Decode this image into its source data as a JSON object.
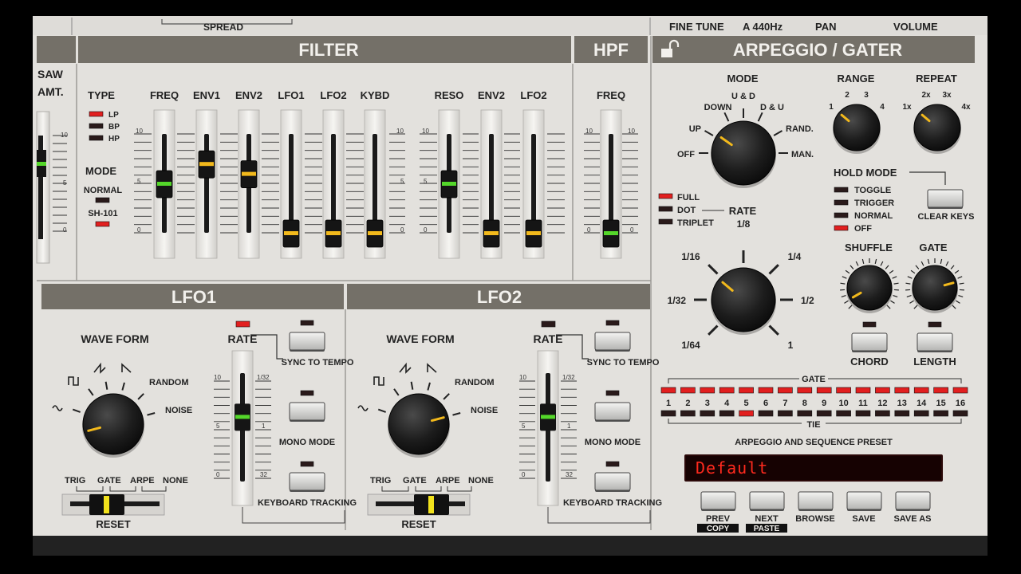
{
  "top_strip": {
    "spread": "SPREAD",
    "fine_tune": "FINE TUNE",
    "a440": "A 440Hz",
    "pan": "PAN",
    "volume": "VOLUME"
  },
  "osc": {
    "saw": "SAW",
    "amt": "AMT."
  },
  "filter": {
    "title": "FILTER",
    "type_label": "TYPE",
    "types": [
      {
        "label": "LP",
        "on": true
      },
      {
        "label": "BP",
        "on": false
      },
      {
        "label": "HP",
        "on": false
      }
    ],
    "mode_label": "MODE",
    "modes": [
      {
        "label": "NORMAL",
        "on": false
      },
      {
        "label": "SH-101",
        "on": true
      }
    ],
    "sliders": [
      {
        "label": "FREQ",
        "value": 0.5,
        "cap": "green"
      },
      {
        "label": "ENV1",
        "value": 0.7,
        "cap": "yellow"
      },
      {
        "label": "ENV2",
        "value": 0.6,
        "cap": "yellow"
      },
      {
        "label": "LFO1",
        "value": 0.0,
        "cap": "yellow"
      },
      {
        "label": "LFO2",
        "value": 0.0,
        "cap": "yellow"
      },
      {
        "label": "KYBD",
        "value": 0.0,
        "cap": "yellow"
      },
      {
        "label": "RESO",
        "value": 0.5,
        "cap": "green"
      },
      {
        "label": "ENV2",
        "value": 0.0,
        "cap": "yellow"
      },
      {
        "label": "LFO2",
        "value": 0.0,
        "cap": "yellow"
      }
    ],
    "scale": {
      "max": "10",
      "mid": "5",
      "min": "0"
    }
  },
  "hpf": {
    "title": "HPF",
    "freq_label": "FREQ",
    "value": 0.0,
    "cap": "green"
  },
  "lfo1": {
    "title": "LFO1",
    "waveform_label": "WAVE FORM",
    "random": "RANDOM",
    "noise": "NOISE",
    "rate_label": "RATE",
    "sync_label": "SYNC TO TEMPO",
    "mono_label": "MONO MODE",
    "kbd_label": "KEYBOARD TRACKING",
    "reset_opts": [
      "TRIG",
      "GATE",
      "ARPE",
      "NONE"
    ],
    "reset_label": "RESET",
    "rate_value": 0.6,
    "rate_led": true,
    "scale": {
      "max": "10",
      "max2": "1/32",
      "mid": "5",
      "mid2": "1",
      "min": "0",
      "min2": "32"
    }
  },
  "lfo2": {
    "title": "LFO2",
    "waveform_label": "WAVE FORM",
    "random": "RANDOM",
    "noise": "NOISE",
    "rate_label": "RATE",
    "sync_label": "SYNC TO TEMPO",
    "mono_label": "MONO MODE",
    "kbd_label": "KEYBOARD TRACKING",
    "reset_opts": [
      "TRIG",
      "GATE",
      "ARPE",
      "NONE"
    ],
    "reset_label": "RESET",
    "rate_value": 0.6,
    "rate_led": false,
    "scale": {
      "max": "10",
      "max2": "1/32",
      "mid": "5",
      "mid2": "1",
      "min": "0",
      "min2": "32"
    }
  },
  "arp": {
    "title": "ARPEGGIO / GATER",
    "mode_label": "MODE",
    "mode_opts": [
      "OFF",
      "UP",
      "DOWN",
      "U & D",
      "D & U",
      "RAND.",
      "MAN."
    ],
    "range_label": "RANGE",
    "range_opts": [
      "1",
      "2",
      "3",
      "4"
    ],
    "repeat_label": "REPEAT",
    "repeat_opts": [
      "1x",
      "2x",
      "3x",
      "4x"
    ],
    "hold_label": "HOLD MODE",
    "hold_opts": [
      {
        "label": "TOGGLE",
        "on": false
      },
      {
        "label": "TRIGGER",
        "on": false
      },
      {
        "label": "NORMAL",
        "on": false
      },
      {
        "label": "OFF",
        "on": true
      }
    ],
    "clear_keys": "CLEAR KEYS",
    "rate_types": [
      {
        "label": "FULL",
        "on": true
      },
      {
        "label": "DOT",
        "on": false
      },
      {
        "label": "TRIPLET",
        "on": false
      }
    ],
    "rate_label": "RATE",
    "rate_opts": [
      "1/64",
      "1/32",
      "1/16",
      "1/8",
      "1/4",
      "1/2",
      "1"
    ],
    "shuffle_label": "SHUFFLE",
    "gate_label": "GATE",
    "chord_label": "CHORD",
    "length_label": "LENGTH",
    "gate_header": "GATE",
    "tie_header": "TIE",
    "steps": [
      "1",
      "2",
      "3",
      "4",
      "5",
      "6",
      "7",
      "8",
      "9",
      "10",
      "11",
      "12",
      "13",
      "14",
      "15",
      "16"
    ],
    "tie_on_step": "5",
    "preset_label": "ARPEGGIO AND SEQUENCE PRESET",
    "preset_name": "Default",
    "buttons": [
      {
        "label": "PREV",
        "sub": "COPY"
      },
      {
        "label": "NEXT",
        "sub": "PASTE"
      },
      {
        "label": "BROWSE",
        "sub": ""
      },
      {
        "label": "SAVE",
        "sub": ""
      },
      {
        "label": "SAVE AS",
        "sub": ""
      }
    ]
  },
  "colors": {
    "panel": "#e3e1dd",
    "header": "#747068",
    "led_red": "#e21f1f",
    "cap_green": "#54d72a",
    "cap_yellow": "#f2b91c",
    "lcd_text": "#ff2a1e"
  }
}
